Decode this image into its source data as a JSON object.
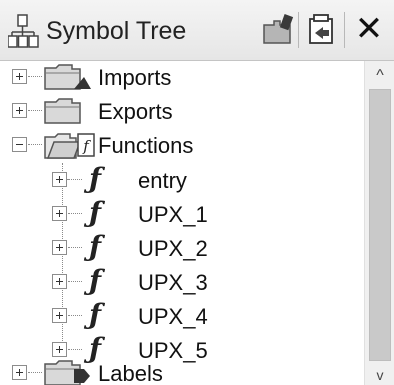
{
  "title": "Symbol Tree",
  "toolbar": {
    "snapshot_icon": "snapshot-icon",
    "export_icon": "export-tree-icon",
    "close_icon": "close-icon",
    "close_glyph": "✕"
  },
  "tree": {
    "categories": [
      {
        "label": "Imports",
        "expanded": false
      },
      {
        "label": "Exports",
        "expanded": false
      },
      {
        "label": "Functions",
        "expanded": true
      },
      {
        "label": "Labels",
        "expanded": false
      }
    ],
    "functions": [
      {
        "label": "entry"
      },
      {
        "label": "UPX_1"
      },
      {
        "label": "UPX_2"
      },
      {
        "label": "UPX_3"
      },
      {
        "label": "UPX_4"
      },
      {
        "label": "UPX_5"
      }
    ]
  },
  "scrollbar": {
    "up_arrow": "^",
    "down_arrow": "v"
  },
  "colors": {
    "folder_fill": "#d9d9d9",
    "folder_stroke": "#555555"
  }
}
